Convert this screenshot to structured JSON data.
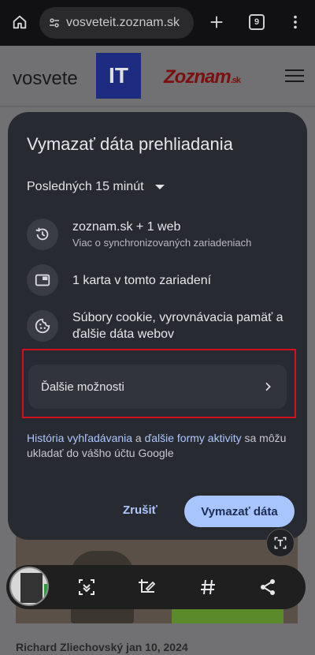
{
  "browser": {
    "url": "vosveteit.zoznam.sk",
    "tab_count": "9"
  },
  "site": {
    "logo_text": "vosvete",
    "logo_it": "IT",
    "partner_logo": "Zoznam",
    "partner_logo_suffix": ".sk",
    "author_line": "Richard Zliechovský  jan 10, 2024"
  },
  "dialog": {
    "title": "Vymazať dáta prehliadania",
    "time_range": "Posledných 15 minút",
    "items": [
      {
        "icon": "history-icon",
        "label": "zoznam.sk + 1 web",
        "sublabel": "Viac o synchronizovaných zariadeniach"
      },
      {
        "icon": "tab-icon",
        "label": "1 karta v tomto zariadení",
        "sublabel": ""
      },
      {
        "icon": "cookie-icon",
        "label": "Súbory cookie, vyrovnávacia pamäť a ďalšie dáta webov",
        "sublabel": ""
      }
    ],
    "more_options": "Ďalšie možnosti",
    "footnote": {
      "link1": "História vyhľadávania",
      "mid": " a ",
      "link2": "ďalšie formy aktivity",
      "rest": " sa môžu ukladať do vášho účtu Google"
    },
    "cancel": "Zrušiť",
    "confirm": "Vymazať dáta"
  },
  "colors": {
    "dialog_bg": "#282a31",
    "accent": "#a8c5ff",
    "highlight": "#d4111a"
  }
}
